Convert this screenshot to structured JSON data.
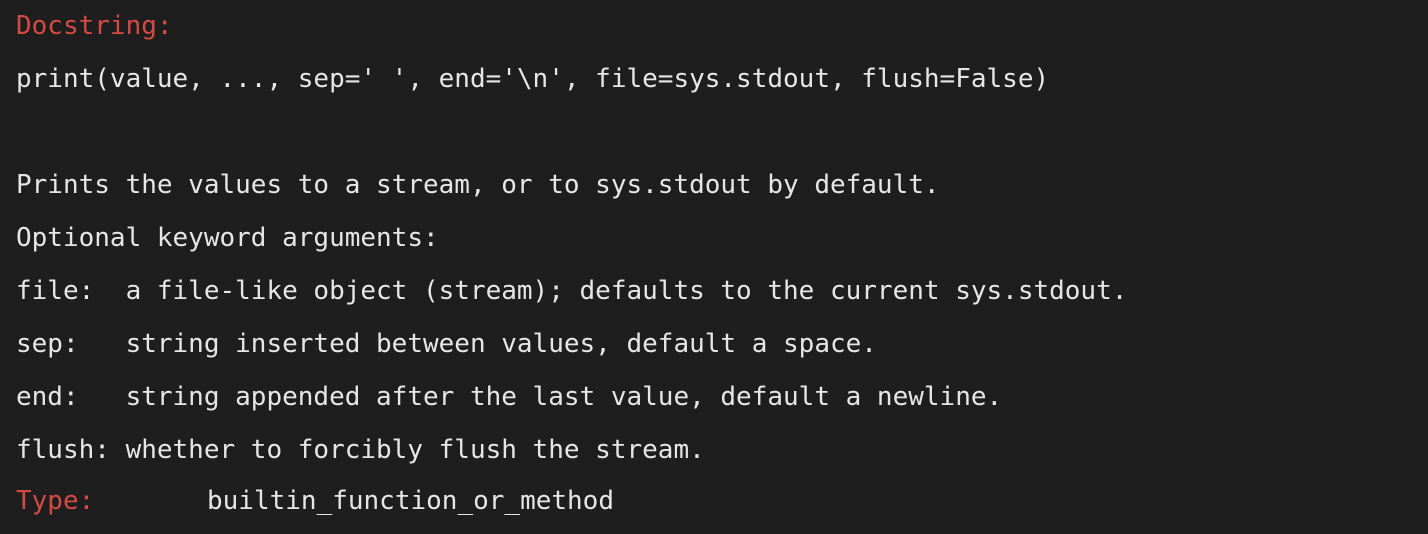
{
  "colors": {
    "background": "#1e1e1e",
    "text": "#e6e6e6",
    "label": "#d34b43"
  },
  "docstring": {
    "label": "Docstring:",
    "signature": "print(value, ..., sep=' ', end='\\n', file=sys.stdout, flush=False)",
    "description": "Prints the values to a stream, or to sys.stdout by default.",
    "optional_header": "Optional keyword arguments:",
    "params": [
      "file:  a file-like object (stream); defaults to the current sys.stdout.",
      "sep:   string inserted between values, default a space.",
      "end:   string appended after the last value, default a newline.",
      "flush: whether to forcibly flush the stream."
    ]
  },
  "type_info": {
    "label": "Type:",
    "value": "builtin_function_or_method"
  }
}
